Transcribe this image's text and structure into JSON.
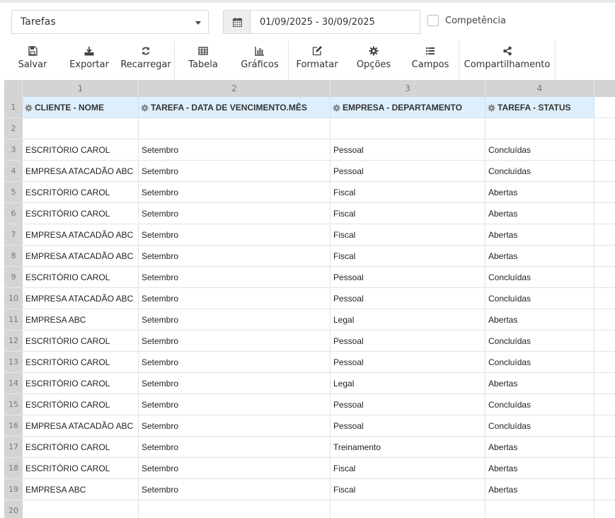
{
  "filters": {
    "report": "Tarefas",
    "date_range": "01/09/2025 - 30/09/2025",
    "competencia_label": "Competência",
    "competencia_checked": false
  },
  "toolbar": {
    "salvar": "Salvar",
    "exportar": "Exportar",
    "recarregar": "Recarregar",
    "tabela": "Tabela",
    "graficos": "Gráficos",
    "formatar": "Formatar",
    "opcoes": "Opções",
    "campos": "Campos",
    "compartilhamento": "Compartilhamento"
  },
  "grid": {
    "column_numbers": [
      "1",
      "2",
      "3",
      "4"
    ],
    "row_numbers": [
      "1",
      "2",
      "3",
      "4",
      "5",
      "6",
      "7",
      "8",
      "9",
      "10",
      "11",
      "12",
      "13",
      "14",
      "15",
      "16",
      "17",
      "18",
      "19",
      "20"
    ],
    "headers": [
      "CLIENTE - NOME",
      "TAREFA - DATA DE VENCIMENTO.MÊS",
      "EMPRESA - DEPARTAMENTO",
      "TAREFA - STATUS"
    ],
    "rows": [
      [
        "",
        "",
        "",
        ""
      ],
      [
        "ESCRITÓRIO CAROL",
        "Setembro",
        "Pessoal",
        "Concluídas"
      ],
      [
        "EMPRESA ATACADÃO ABC",
        "Setembro",
        "Pessoal",
        "Concluídas"
      ],
      [
        "ESCRITÓRIO CAROL",
        "Setembro",
        "Fiscal",
        "Abertas"
      ],
      [
        "ESCRITÓRIO CAROL",
        "Setembro",
        "Fiscal",
        "Abertas"
      ],
      [
        "EMPRESA ATACADÃO ABC",
        "Setembro",
        "Fiscal",
        "Abertas"
      ],
      [
        "EMPRESA ATACADÃO ABC",
        "Setembro",
        "Fiscal",
        "Abertas"
      ],
      [
        "ESCRITÓRIO CAROL",
        "Setembro",
        "Pessoal",
        "Concluídas"
      ],
      [
        "EMPRESA ATACADÃO ABC",
        "Setembro",
        "Pessoal",
        "Concluídas"
      ],
      [
        "EMPRESA ABC",
        "Setembro",
        "Legal",
        "Abertas"
      ],
      [
        "ESCRITÓRIO CAROL",
        "Setembro",
        "Pessoal",
        "Concluídas"
      ],
      [
        "ESCRITÓRIO CAROL",
        "Setembro",
        "Pessoal",
        "Concluídas"
      ],
      [
        "ESCRITÓRIO CAROL",
        "Setembro",
        "Legal",
        "Abertas"
      ],
      [
        "ESCRITÓRIO CAROL",
        "Setembro",
        "Pessoal",
        "Concluídas"
      ],
      [
        "EMPRESA ATACADÃO ABC",
        "Setembro",
        "Pessoal",
        "Concluídas"
      ],
      [
        "ESCRITÓRIO CAROL",
        "Setembro",
        "Treinamento",
        "Abertas"
      ],
      [
        "ESCRITÓRIO CAROL",
        "Setembro",
        "Fiscal",
        "Abertas"
      ],
      [
        "EMPRESA ABC",
        "Setembro",
        "Fiscal",
        "Abertas"
      ],
      [
        "",
        "",
        "",
        ""
      ]
    ]
  }
}
